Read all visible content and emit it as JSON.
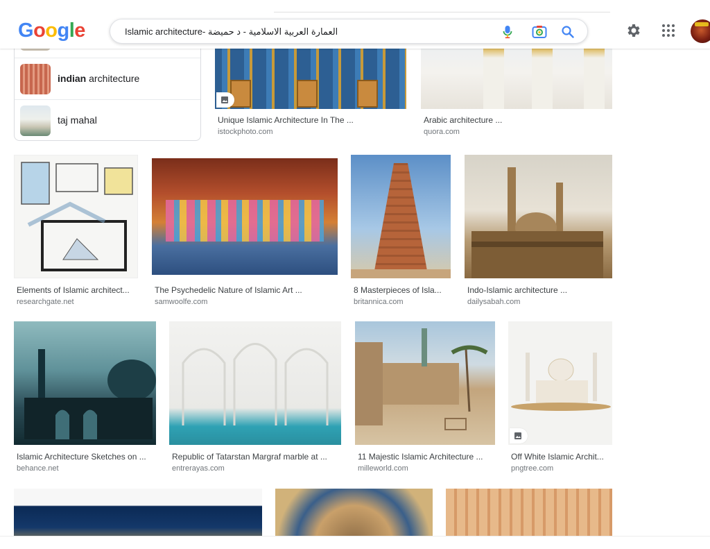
{
  "header": {
    "logo_letters": [
      "G",
      "o",
      "o",
      "g",
      "l",
      "e"
    ],
    "logo_colors": [
      "#4285f4",
      "#ea4335",
      "#fbbc05",
      "#4285f4",
      "#34a853",
      "#ea4335"
    ],
    "search_query": "Islamic architecture- العمارة العربية الاسلامية - د حميضة",
    "icons": [
      "mic-icon",
      "camera-lens-icon",
      "search-icon",
      "gear-icon",
      "apps-grid-icon",
      "avatar"
    ]
  },
  "related": {
    "items": [
      {
        "bold": "indian",
        "rest": " architecture"
      },
      {
        "bold": "",
        "rest": "taj mahal"
      }
    ]
  },
  "results": [
    {
      "title": "Unique Islamic Architecture In The ...",
      "source": "istockphoto.com",
      "has_badge": true
    },
    {
      "title": "Arabic architecture ...",
      "source": "quora.com",
      "has_badge": false
    },
    {
      "title": "Elements of Islamic architect...",
      "source": "researchgate.net",
      "has_badge": false
    },
    {
      "title": "The Psychedelic Nature of Islamic Art ...",
      "source": "samwoolfe.com",
      "has_badge": false
    },
    {
      "title": "8 Masterpieces of Isla...",
      "source": "britannica.com",
      "has_badge": false
    },
    {
      "title": "Indo-Islamic architecture ...",
      "source": "dailysabah.com",
      "has_badge": false
    },
    {
      "title": "Islamic Architecture Sketches on ...",
      "source": "behance.net",
      "has_badge": false
    },
    {
      "title": "Republic of Tatarstan Margraf marble at ...",
      "source": "entrerayas.com",
      "has_badge": false
    },
    {
      "title": "11 Majestic Islamic Architecture ...",
      "source": "milleworld.com",
      "has_badge": false
    },
    {
      "title": "Off White Islamic Archit...",
      "source": "pngtree.com",
      "has_badge": true
    }
  ],
  "colors": {
    "accent_blue": "#4285f4",
    "text": "#202124",
    "muted": "#70757a"
  }
}
